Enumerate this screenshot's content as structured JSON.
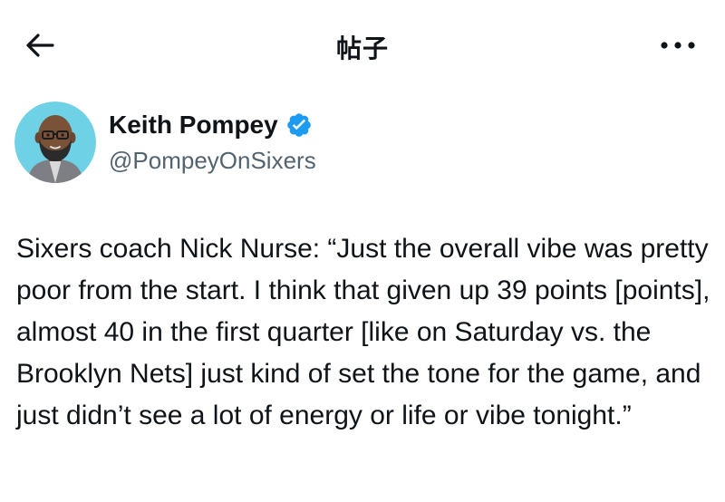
{
  "header": {
    "title": "帖子",
    "back_icon": "arrow-left-icon",
    "more_icon": "more-horizontal-icon"
  },
  "author": {
    "display_name": "Keith Pompey",
    "handle": "@PompeyOnSixers",
    "verified": true,
    "verified_icon": "verified-badge-icon",
    "avatar_icon": "avatar-icon"
  },
  "tweet": {
    "text": "Sixers coach Nick Nurse: “Just the overall vibe was pretty poor from the start. I think that given up 39 points [points], almost 40 in the first quarter [like on Saturday vs. the Brooklyn Nets] just kind of set the tone for the game, and just didn’t see a lot of energy or life or vibe tonight.”"
  },
  "colors": {
    "text_primary": "#0f1419",
    "text_secondary": "#536471",
    "verified_blue": "#1d9bf0",
    "avatar_bg": "#6fd1e6"
  }
}
